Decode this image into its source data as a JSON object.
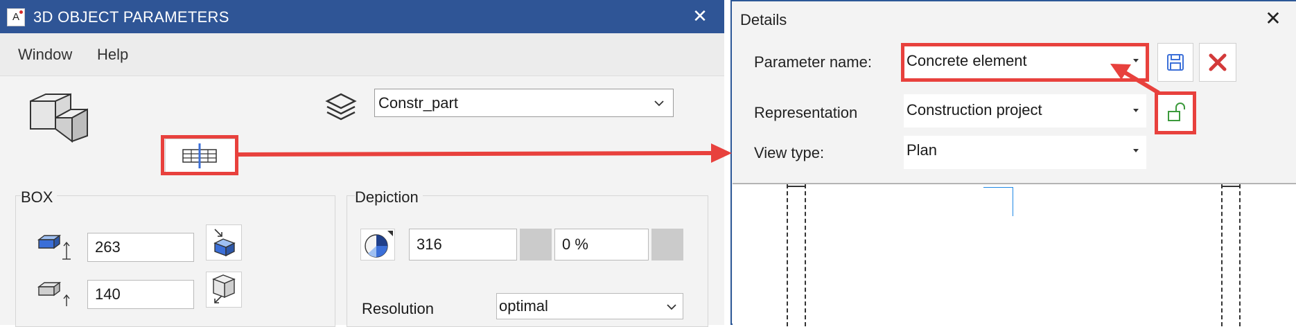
{
  "left_window": {
    "title": "3D OBJECT PARAMETERS",
    "logo": "A",
    "close_glyph": "✕",
    "menu": [
      "Window",
      "Help"
    ],
    "layer": {
      "value": "Constr_part"
    },
    "box": {
      "label": "BOX",
      "height": "263",
      "base": "140"
    },
    "depiction": {
      "label": "Depiction",
      "pen": "316",
      "percent": "0 %",
      "resolution_label": "Resolution",
      "resolution_value": "optimal"
    }
  },
  "right_window": {
    "title": "Details",
    "close_glyph": "✕",
    "parameter_name": {
      "label": "Parameter name:",
      "value": "Concrete element"
    },
    "representation": {
      "label": "Representation",
      "value": "Construction project"
    },
    "view_type": {
      "label": "View type:",
      "value": "Plan"
    }
  },
  "colors": {
    "title_bar": "#2f5596",
    "highlight": "#e8413d",
    "accent_blue": "#3b6fd8",
    "delete_red": "#d33a3a",
    "lock_green": "#3c9a3c"
  },
  "icons": [
    "app-logo",
    "close-icon",
    "box-3d-icon",
    "layers-icon",
    "chevron-down-icon",
    "reference-point-icon",
    "box-height-icon",
    "box-base-icon",
    "pen-icon",
    "save-icon",
    "delete-icon",
    "unlock-icon"
  ]
}
